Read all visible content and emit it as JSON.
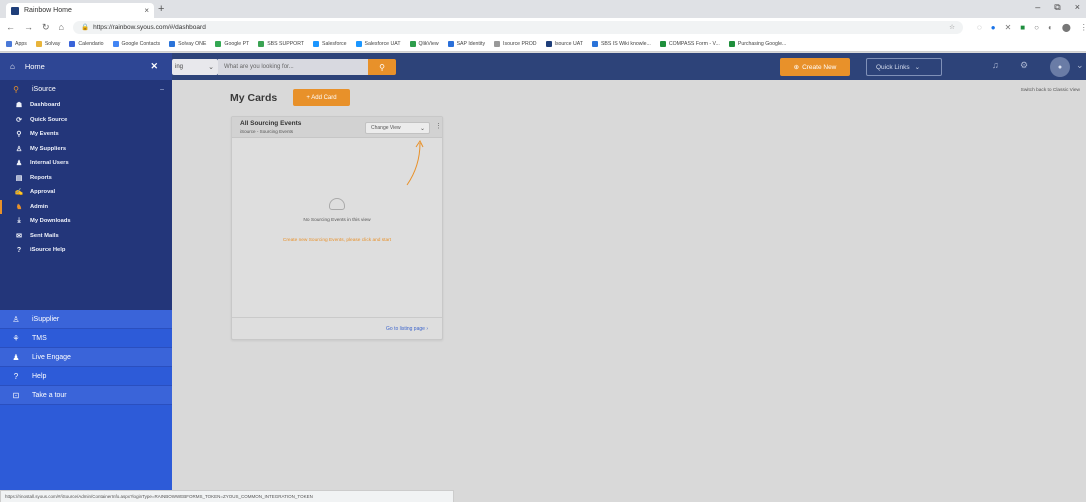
{
  "browser": {
    "tab_title": "Rainbow Home",
    "tab_close": "×",
    "new_tab": "+",
    "window_controls": [
      "–",
      "⧉",
      "×"
    ],
    "url": "https://rainbow.syous.com/#/dashboard",
    "bookmarks": [
      {
        "label": "Apps",
        "color": "#4a79d8"
      },
      {
        "label": "Solvay",
        "color": "#e8b43a"
      },
      {
        "label": "Calendario",
        "color": "#3a64d9"
      },
      {
        "label": "Google Contacts",
        "color": "#4285f4"
      },
      {
        "label": "Solvay ONE",
        "color": "#2a73d9"
      },
      {
        "label": "Google PT",
        "color": "#34a853"
      },
      {
        "label": "SBS SUPPORT",
        "color": "#3aa353"
      },
      {
        "label": "Salesforce",
        "color": "#1b96ff"
      },
      {
        "label": "Salesforce UAT",
        "color": "#1b96ff"
      },
      {
        "label": "QlikView",
        "color": "#2d9d4c"
      },
      {
        "label": "SAP Identity",
        "color": "#2a6fd9"
      },
      {
        "label": "Isource PROD",
        "color": "#999999"
      },
      {
        "label": "Isource UAT",
        "color": "#1f3f7a"
      },
      {
        "label": "SBS IS Wiki knowle...",
        "color": "#2a73d9"
      },
      {
        "label": "COMPASS Form - V...",
        "color": "#1f8f3c"
      },
      {
        "label": "Purchasing Google...",
        "color": "#1f8f3c"
      }
    ]
  },
  "header": {
    "dropdown_label": "ing",
    "search_placeholder": "What are you looking for...",
    "create_new": "Create New",
    "quick_links": "Quick Links"
  },
  "sidebar": {
    "home": "Home",
    "isource": "iSource",
    "isource_items": [
      {
        "label": "Dashboard",
        "icon": "dashboard-icon",
        "glyph": "☗"
      },
      {
        "label": "Quick Source",
        "icon": "quick-source-icon",
        "glyph": "⟳"
      },
      {
        "label": "My Events",
        "icon": "my-events-icon",
        "glyph": "⚲"
      },
      {
        "label": "My Suppliers",
        "icon": "suppliers-icon",
        "glyph": "♙"
      },
      {
        "label": "Internal Users",
        "icon": "internal-users-icon",
        "glyph": "♟"
      },
      {
        "label": "Reports",
        "icon": "reports-icon",
        "glyph": "▤"
      },
      {
        "label": "Approval",
        "icon": "approval-icon",
        "glyph": "✍"
      },
      {
        "label": "Admin",
        "icon": "admin-icon",
        "glyph": "♞"
      },
      {
        "label": "My Downloads",
        "icon": "download-icon",
        "glyph": "⤓"
      },
      {
        "label": "Sent Mails",
        "icon": "mail-icon",
        "glyph": "✉"
      },
      {
        "label": "iSource Help",
        "icon": "help-circle-icon",
        "glyph": "?"
      }
    ],
    "main_items": [
      {
        "label": "iSupplier",
        "icon": "supplier-icon",
        "glyph": "♙"
      },
      {
        "label": "TMS",
        "icon": "tms-icon",
        "glyph": "⚘"
      },
      {
        "label": "Live Engage",
        "icon": "live-engage-icon",
        "glyph": "♟"
      },
      {
        "label": "Help",
        "icon": "help-icon",
        "glyph": "?"
      },
      {
        "label": "Take a tour",
        "icon": "tour-icon",
        "glyph": "⊡"
      }
    ]
  },
  "content": {
    "switch_back": "Switch back to Classic View",
    "title": "My Cards",
    "add_card": "+ Add Card",
    "card": {
      "title": "All Sourcing Events",
      "subtitle": "iSource - Sourcing Events",
      "change_view": "Change View",
      "empty_text": "No Sourcing Events in this view",
      "create_text": "Create new Sourcing Events, please click and start",
      "goto": "Go to listing page"
    }
  },
  "status_url": "https://rinostall.syous.com/#/iSource/Admin/ContainerInfo.aspx?loginType=RAINBOWWEBFORMS_TOKEN=ZYOUS_COMMON_INTEGRATION_TOKEN",
  "colors": {
    "header_bg": "#2d4379",
    "sidebar_bg": "#2d5bd8",
    "sidebar_section_bg": "#23367a",
    "accent": "#e8912a",
    "content_bg": "#d9d9d9"
  }
}
